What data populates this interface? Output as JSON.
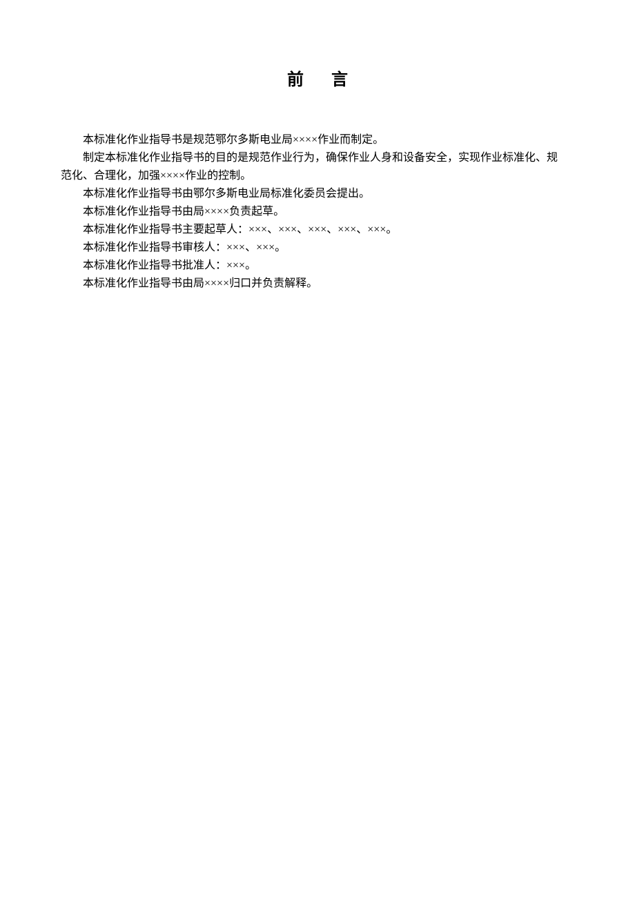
{
  "title": "前言",
  "paragraphs": {
    "p1": "本标准化作业指导书是规范鄂尔多斯电业局××××作业而制定。",
    "p2_line1": "制定本标准化作业指导书的目的是规范作业行为，确保作业人身和设备安全，实现作业标准化、规",
    "p2_line2": "范化、合理化，加强××××作业的控制。",
    "p3": "本标准化作业指导书由鄂尔多斯电业局标准化委员会提出。",
    "p4": "本标准化作业指导书由局××××负责起草。",
    "p5": "本标准化作业指导书主要起草人：×××、×××、×××、×××、×××。",
    "p6": "本标准化作业指导书审核人：×××、×××。",
    "p7": "本标准化作业指导书批准人：×××。",
    "p8": "本标准化作业指导书由局××××归口并负责解释。"
  }
}
